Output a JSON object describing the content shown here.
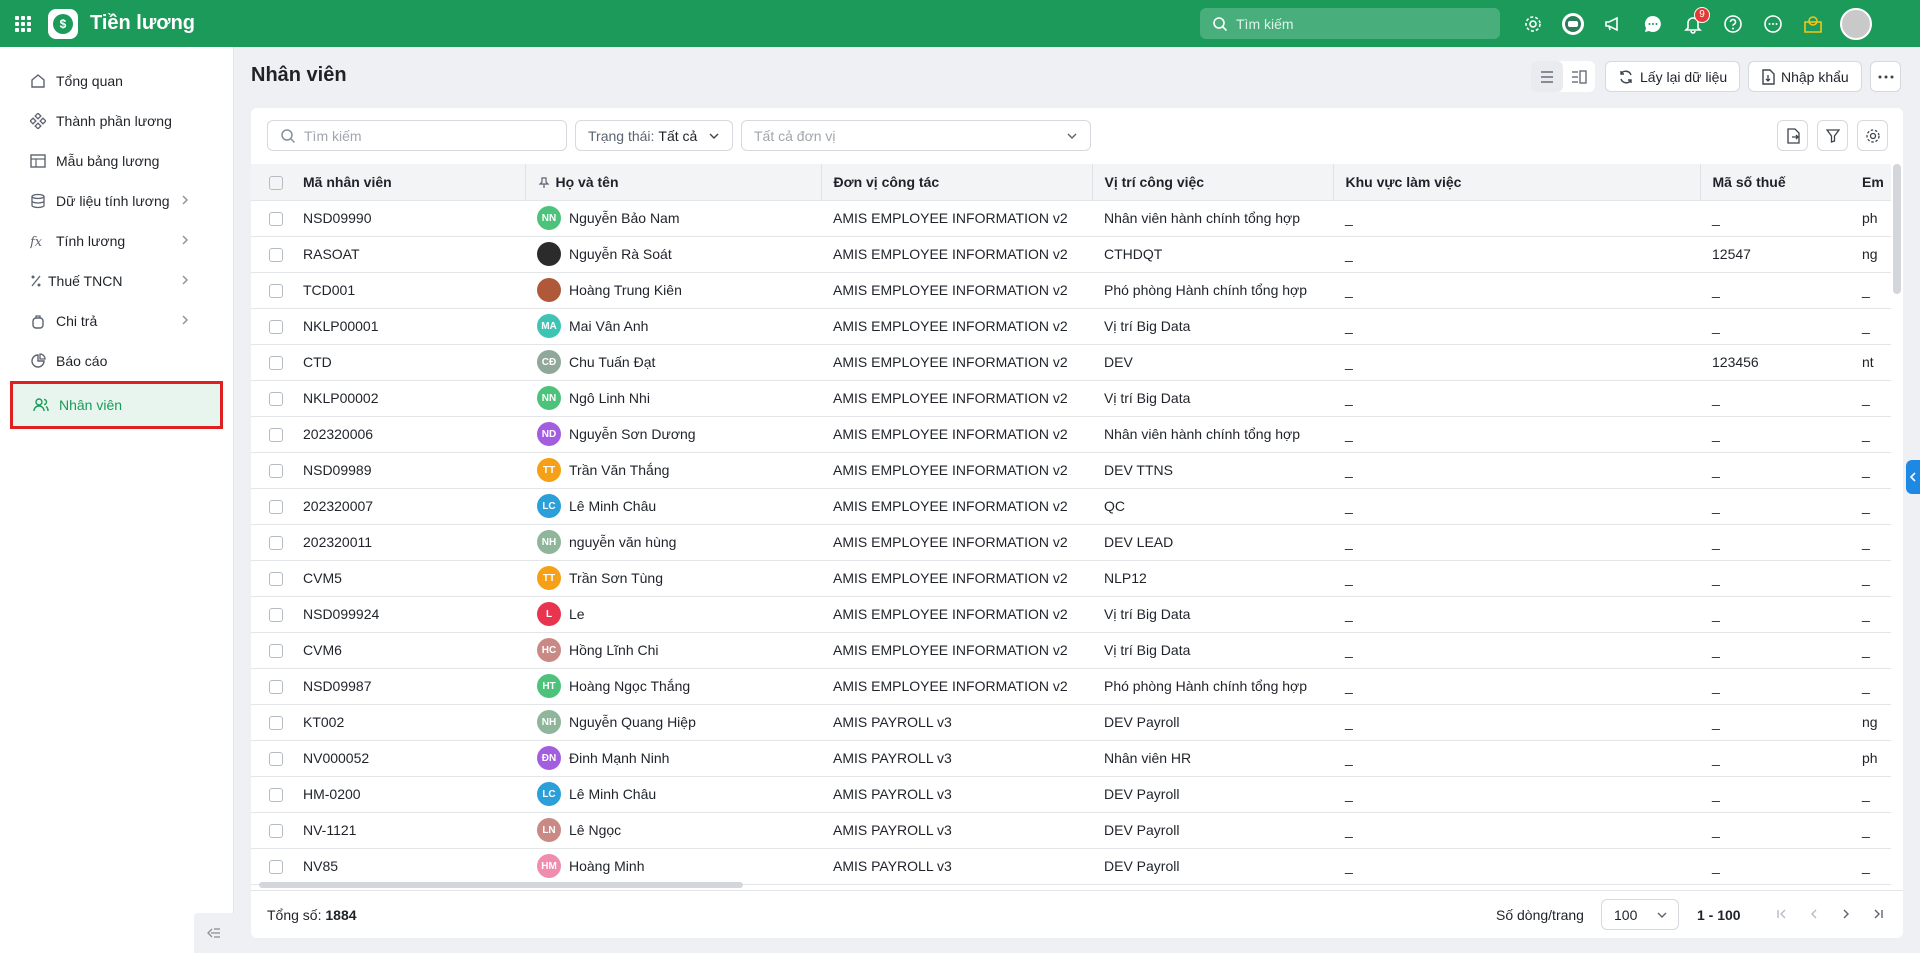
{
  "app": {
    "title": "Tiền lương"
  },
  "topbar": {
    "search_placeholder": "Tìm kiếm",
    "notification_count": "9",
    "icons": [
      "settings-icon",
      "robot-icon",
      "megaphone-icon",
      "chat-icon",
      "bell-icon",
      "help-icon",
      "more-circle-icon",
      "location-icon"
    ]
  },
  "sidebar": {
    "items": [
      {
        "label": "Tổng quan",
        "icon": "home-icon"
      },
      {
        "label": "Thành phần lương",
        "icon": "components-icon"
      },
      {
        "label": "Mẫu bảng lương",
        "icon": "template-icon"
      },
      {
        "label": "Dữ liệu tính lương",
        "icon": "database-icon"
      },
      {
        "label": "Tính lương",
        "icon": "formula-icon"
      },
      {
        "label": "Thuế TNCN",
        "icon": "percent-icon"
      },
      {
        "label": "Chi trả",
        "icon": "wallet-icon"
      },
      {
        "label": "Báo cáo",
        "icon": "report-icon"
      },
      {
        "label": "Nhân viên",
        "icon": "users-icon"
      }
    ],
    "active": "Nhân viên"
  },
  "page": {
    "title": "Nhân viên",
    "reload_label": "Lấy lại dữ liệu",
    "import_label": "Nhập khẩu"
  },
  "filters": {
    "search_placeholder": "Tìm kiếm",
    "status_label": "Trạng thái:",
    "status_value": "Tất cả",
    "unit_placeholder": "Tất cả đơn vị"
  },
  "table": {
    "headers": [
      "Mã nhân viên",
      "Họ và tên",
      "Đơn vị công tác",
      "Vị trí công việc",
      "Khu vực làm việc",
      "Mã số thuế",
      "Em"
    ],
    "rows": [
      {
        "code": "NSD09990",
        "initials": "NN",
        "color": "#4cc27a",
        "name": "Nguyễn Bảo Nam",
        "unit": "AMIS EMPLOYEE INFORMATION v2",
        "position": "Nhân viên hành chính tổng hợp",
        "area": "_",
        "tax": "_",
        "em": "ph"
      },
      {
        "code": "RASOAT",
        "initials": "",
        "color": "#2b2b2b",
        "name": "Nguyễn Rà Soát",
        "unit": "AMIS EMPLOYEE INFORMATION v2",
        "position": "CTHDQT",
        "area": "_",
        "tax": "12547",
        "em": "ng"
      },
      {
        "code": "TCD001",
        "initials": "",
        "color": "#b0583a",
        "name": "Hoàng Trung Kiên",
        "unit": "AMIS EMPLOYEE INFORMATION v2",
        "position": "Phó phòng Hành chính tổng hợp",
        "area": "_",
        "tax": "_",
        "em": "_"
      },
      {
        "code": "NKLP00001",
        "initials": "MA",
        "color": "#3dc4b4",
        "name": "Mai Vân Anh",
        "unit": "AMIS EMPLOYEE INFORMATION v2",
        "position": "Vị trí Big Data",
        "area": "_",
        "tax": "_",
        "em": "_"
      },
      {
        "code": "CTD",
        "initials": "CĐ",
        "color": "#8fa89a",
        "name": "Chu Tuấn Đạt",
        "unit": "AMIS EMPLOYEE INFORMATION v2",
        "position": "DEV",
        "area": "_",
        "tax": "123456",
        "em": "nt"
      },
      {
        "code": "NKLP00002",
        "initials": "NN",
        "color": "#4cc27a",
        "name": "Ngô Linh Nhi",
        "unit": "AMIS EMPLOYEE INFORMATION v2",
        "position": "Vị trí Big Data",
        "area": "_",
        "tax": "_",
        "em": "_"
      },
      {
        "code": "202320006",
        "initials": "ND",
        "color": "#a35ee0",
        "name": "Nguyễn Sơn Dương",
        "unit": "AMIS EMPLOYEE INFORMATION v2",
        "position": "Nhân viên hành chính tổng hợp",
        "area": "_",
        "tax": "_",
        "em": "_"
      },
      {
        "code": "NSD09989",
        "initials": "TT",
        "color": "#f5a017",
        "name": "Trần Văn Thắng",
        "unit": "AMIS EMPLOYEE INFORMATION v2",
        "position": "DEV TTNS",
        "area": "_",
        "tax": "_",
        "em": "_"
      },
      {
        "code": "202320007",
        "initials": "LC",
        "color": "#2a9fd8",
        "name": "Lê Minh Châu",
        "unit": "AMIS EMPLOYEE INFORMATION v2",
        "position": "QC",
        "area": "_",
        "tax": "_",
        "em": "_"
      },
      {
        "code": "202320011",
        "initials": "NH",
        "color": "#8fb59a",
        "name": "nguyễn văn hùng",
        "unit": "AMIS EMPLOYEE INFORMATION v2",
        "position": "DEV LEAD",
        "area": "_",
        "tax": "_",
        "em": "_"
      },
      {
        "code": "CVM5",
        "initials": "TT",
        "color": "#f5a017",
        "name": "Trần Sơn Tùng",
        "unit": "AMIS EMPLOYEE INFORMATION v2",
        "position": "NLP12",
        "area": "_",
        "tax": "_",
        "em": "_"
      },
      {
        "code": "NSD099924",
        "initials": "L",
        "color": "#e8344e",
        "name": "Le",
        "unit": "AMIS EMPLOYEE INFORMATION v2",
        "position": "Vị trí Big Data",
        "area": "_",
        "tax": "_",
        "em": "_"
      },
      {
        "code": "CVM6",
        "initials": "HC",
        "color": "#c98a86",
        "name": "Hồng Lĩnh Chi",
        "unit": "AMIS EMPLOYEE INFORMATION v2",
        "position": "Vị trí Big Data",
        "area": "_",
        "tax": "_",
        "em": "_"
      },
      {
        "code": "NSD09987",
        "initials": "HT",
        "color": "#4cc27a",
        "name": "Hoàng Ngọc Thắng",
        "unit": "AMIS EMPLOYEE INFORMATION v2",
        "position": "Phó phòng Hành chính tổng hợp",
        "area": "_",
        "tax": "_",
        "em": "_"
      },
      {
        "code": "KT002",
        "initials": "NH",
        "color": "#8fb59a",
        "name": "Nguyễn Quang Hiệp",
        "unit": "AMIS PAYROLL v3",
        "position": "DEV Payroll",
        "area": "_",
        "tax": "_",
        "em": "ng"
      },
      {
        "code": "NV000052",
        "initials": "ĐN",
        "color": "#a35ee0",
        "name": "Đinh Mạnh Ninh",
        "unit": "AMIS PAYROLL v3",
        "position": "Nhân viên HR",
        "area": "_",
        "tax": "_",
        "em": "ph"
      },
      {
        "code": "HM-0200",
        "initials": "LC",
        "color": "#2a9fd8",
        "name": "Lê Minh Châu",
        "unit": "AMIS PAYROLL v3",
        "position": "DEV Payroll",
        "area": "_",
        "tax": "_",
        "em": "_"
      },
      {
        "code": "NV-1121",
        "initials": "LN",
        "color": "#c98a86",
        "name": "Lê Ngọc",
        "unit": "AMIS PAYROLL v3",
        "position": "DEV Payroll",
        "area": "_",
        "tax": "_",
        "em": "_"
      },
      {
        "code": "NV85",
        "initials": "HM",
        "color": "#f08cae",
        "name": "Hoàng Minh",
        "unit": "AMIS PAYROLL v3",
        "position": "DEV Payroll",
        "area": "_",
        "tax": "_",
        "em": "_"
      }
    ]
  },
  "footer": {
    "total_label": "Tổng số:",
    "total_value": "1884",
    "rows_label": "Số dòng/trang",
    "rows_value": "100",
    "range": "1 - 100"
  }
}
